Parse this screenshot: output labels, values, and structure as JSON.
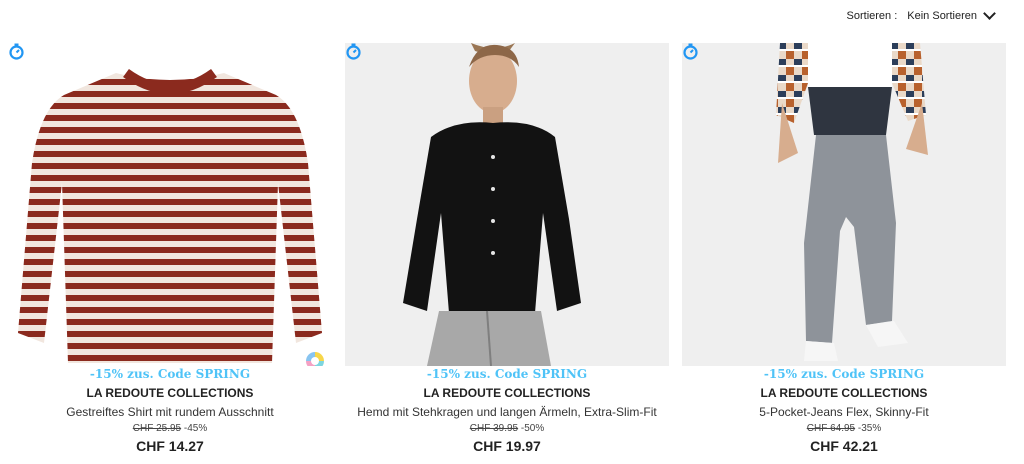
{
  "sort": {
    "label": "Sortieren :",
    "value": "Kein Sortieren",
    "icon": "chevron-down-icon"
  },
  "products": [
    {
      "promo": "-15% zus. Code SPRING",
      "brand": "LA REDOUTE COLLECTIONS",
      "name": "Gestreiftes Shirt mit rundem Ausschnitt",
      "old_price": "CHF 25.95",
      "discount": "-45%",
      "price": "CHF 14.27",
      "badge_icon": "timer-icon",
      "extra_icon": "color-swatch-icon"
    },
    {
      "promo": "-15% zus. Code SPRING",
      "brand": "LA REDOUTE COLLECTIONS",
      "name": "Hemd mit Stehkragen und langen Ärmeln, Extra-Slim-Fit",
      "old_price": "CHF 39.95",
      "discount": "-50%",
      "price": "CHF 19.97",
      "badge_icon": "timer-icon"
    },
    {
      "promo": "-15% zus. Code SPRING",
      "brand": "LA REDOUTE COLLECTIONS",
      "name": "5-Pocket-Jeans Flex, Skinny-Fit",
      "old_price": "CHF 64.95",
      "discount": "-35%",
      "price": "CHF 42.21",
      "badge_icon": "timer-icon"
    }
  ],
  "colors": {
    "promo": "#4fc3f7",
    "timer_icon": "#2196f3"
  }
}
